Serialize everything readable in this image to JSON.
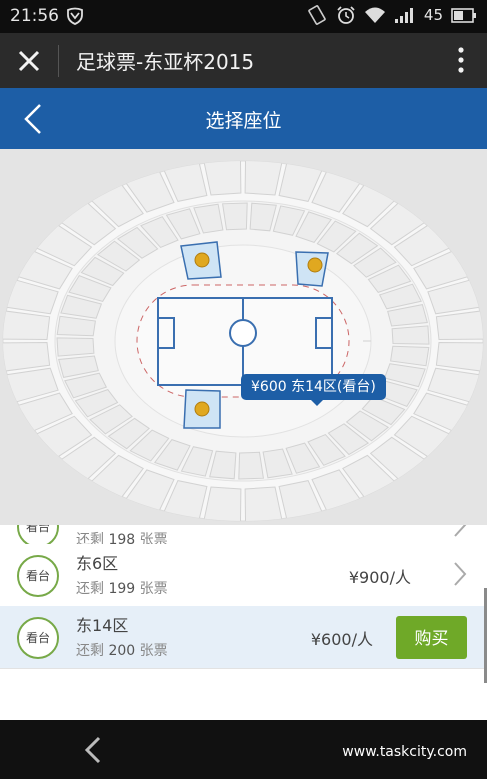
{
  "status_bar": {
    "time": "21:56",
    "battery": "45"
  },
  "topbar": {
    "title": "足球票-东亚杯2015"
  },
  "header": {
    "title": "选择座位"
  },
  "map": {
    "tooltip": "¥600 东14区(看台)"
  },
  "list": {
    "rows": [
      {
        "badge": "看台",
        "zone": "",
        "remain_prefix": "还剩",
        "remain_count": "198",
        "remain_suffix": "张票",
        "price": ""
      },
      {
        "badge": "看台",
        "zone": "东6区",
        "remain_prefix": "还剩",
        "remain_count": "199",
        "remain_suffix": "张票",
        "price": "¥900/人"
      },
      {
        "badge": "看台",
        "zone": "东14区",
        "remain_prefix": "还剩",
        "remain_count": "200",
        "remain_suffix": "张票",
        "price": "¥600/人",
        "buy_label": "购买"
      }
    ]
  },
  "navbar": {
    "watermark": "www.taskcity.com"
  },
  "colors": {
    "header_blue": "#1d5ea6",
    "buy_green": "#6fa928",
    "seat_gold": "#e0a820",
    "selected_row": "#e6eff8"
  }
}
